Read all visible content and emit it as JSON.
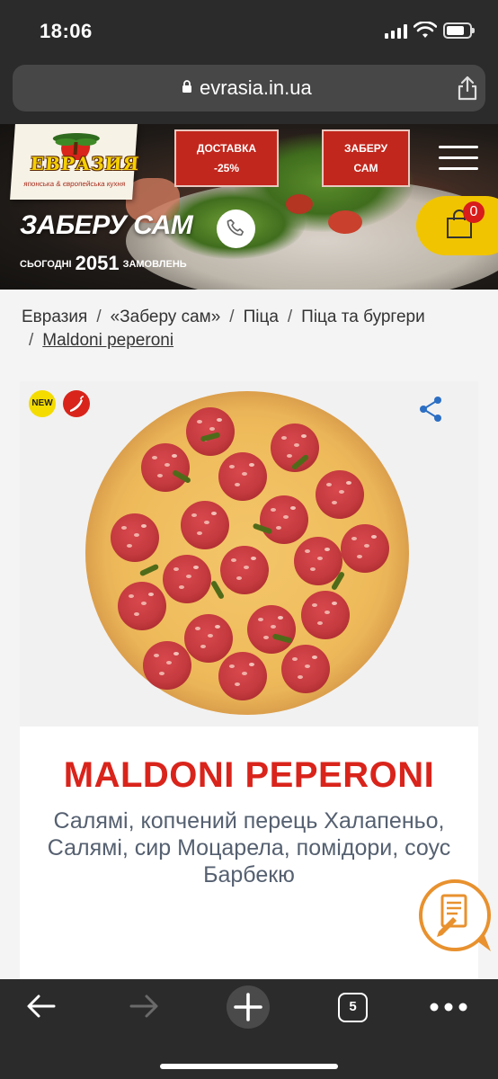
{
  "status_bar": {
    "time": "18:06"
  },
  "browser": {
    "url": "evrasia.in.ua",
    "tab_count": "5"
  },
  "header": {
    "logo_text": "ЕВРАЗИЯ",
    "logo_tagline": "японська & європейська кухня",
    "delivery_line1": "ДОСТАВКА",
    "delivery_line2": "-25%",
    "pickup_line1": "ЗАБЕРУ",
    "pickup_line2": "САМ",
    "page_title": "ЗАБЕРУ САМ",
    "orders_prefix": "СЬОГОДНІ",
    "orders_count": "2051",
    "orders_suffix": "ЗАМОВЛЕНЬ",
    "cart_count": "0"
  },
  "breadcrumbs": [
    "Евразия",
    "«Заберу сам»",
    "Піца",
    "Піца та бургери",
    "Maldoni peperoni"
  ],
  "product": {
    "badge_new": "NEW",
    "name": "MALDONI PEPERONI",
    "description": "Салямі, копчений перець Халапеньо, Салямі, сир Моцарела, помідори, соус Барбекю"
  },
  "colors": {
    "accent_red": "#d9241b",
    "cart_yellow": "#f0c400",
    "button_red": "#c2271d"
  }
}
